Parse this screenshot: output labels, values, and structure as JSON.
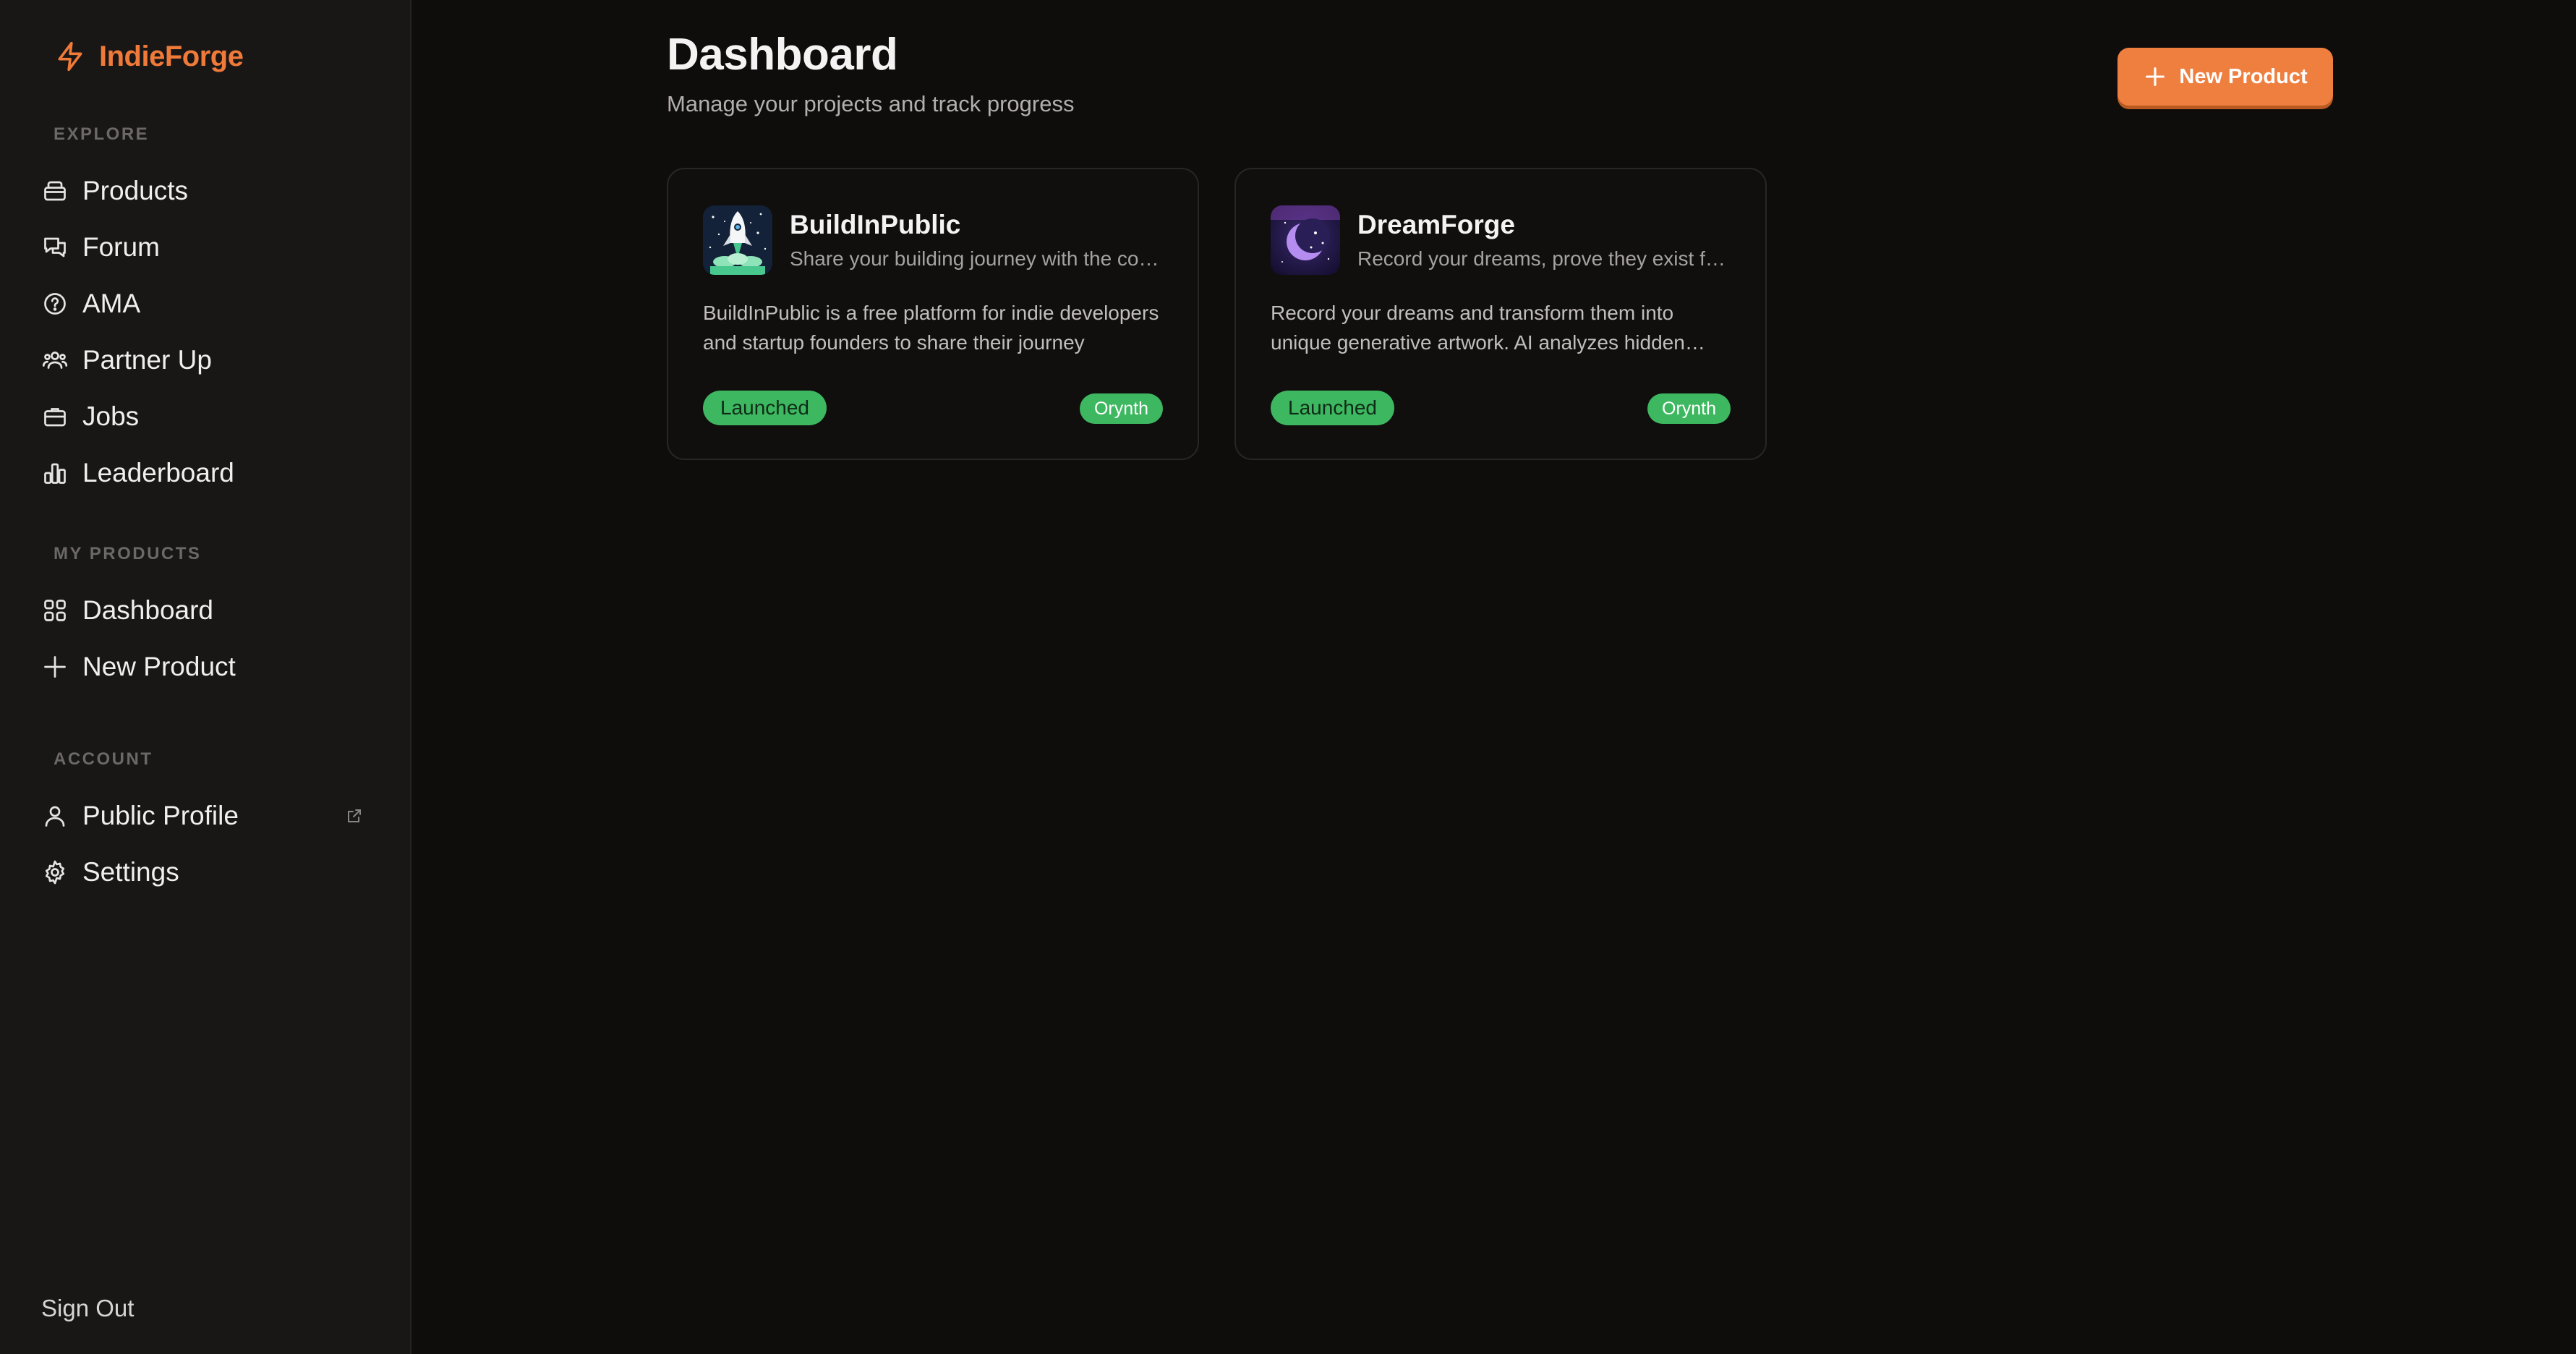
{
  "brand": {
    "name": "IndieForge",
    "accent": "#ef7a39"
  },
  "sidebar": {
    "sections": [
      {
        "label": "EXPLORE"
      },
      {
        "label": "MY PRODUCTS"
      },
      {
        "label": "ACCOUNT"
      }
    ],
    "explore_items": [
      {
        "label": "Products",
        "icon": "package-icon"
      },
      {
        "label": "Forum",
        "icon": "chat-bubbles-icon"
      },
      {
        "label": "AMA",
        "icon": "question-circle-icon"
      },
      {
        "label": "Partner Up",
        "icon": "users-icon"
      },
      {
        "label": "Jobs",
        "icon": "briefcase-icon"
      },
      {
        "label": "Leaderboard",
        "icon": "bar-chart-icon"
      }
    ],
    "product_items": [
      {
        "label": "Dashboard",
        "icon": "grid-icon"
      },
      {
        "label": "New Product",
        "icon": "plus-icon"
      }
    ],
    "account_items": [
      {
        "label": "Public Profile",
        "icon": "user-icon",
        "external": true
      },
      {
        "label": "Settings",
        "icon": "gear-icon"
      }
    ],
    "sign_out": "Sign Out"
  },
  "main": {
    "title": "Dashboard",
    "subtitle": "Manage your projects and track progress",
    "new_button": {
      "label": "New Product",
      "icon": "plus-icon",
      "color": "#ef7f3e"
    }
  },
  "products": [
    {
      "name": "BuildInPublic",
      "tagline": "Share your building journey with the community",
      "description": "BuildInPublic is a free platform for indie developers and startup founders to share their journey",
      "status": "Launched",
      "org": "Orynth",
      "logo": "rocket-logo"
    },
    {
      "name": "DreamForge",
      "tagline": "Record your dreams, prove they exist forever",
      "description": "Record your dreams and transform them into unique generative artwork. AI analyzes hidden meanings",
      "status": "Launched",
      "org": "Orynth",
      "logo": "moon-logo"
    }
  ],
  "colors": {
    "badge_green": "#3db860",
    "sidebar_bg": "#191616",
    "page_bg": "#0f0c0c"
  }
}
